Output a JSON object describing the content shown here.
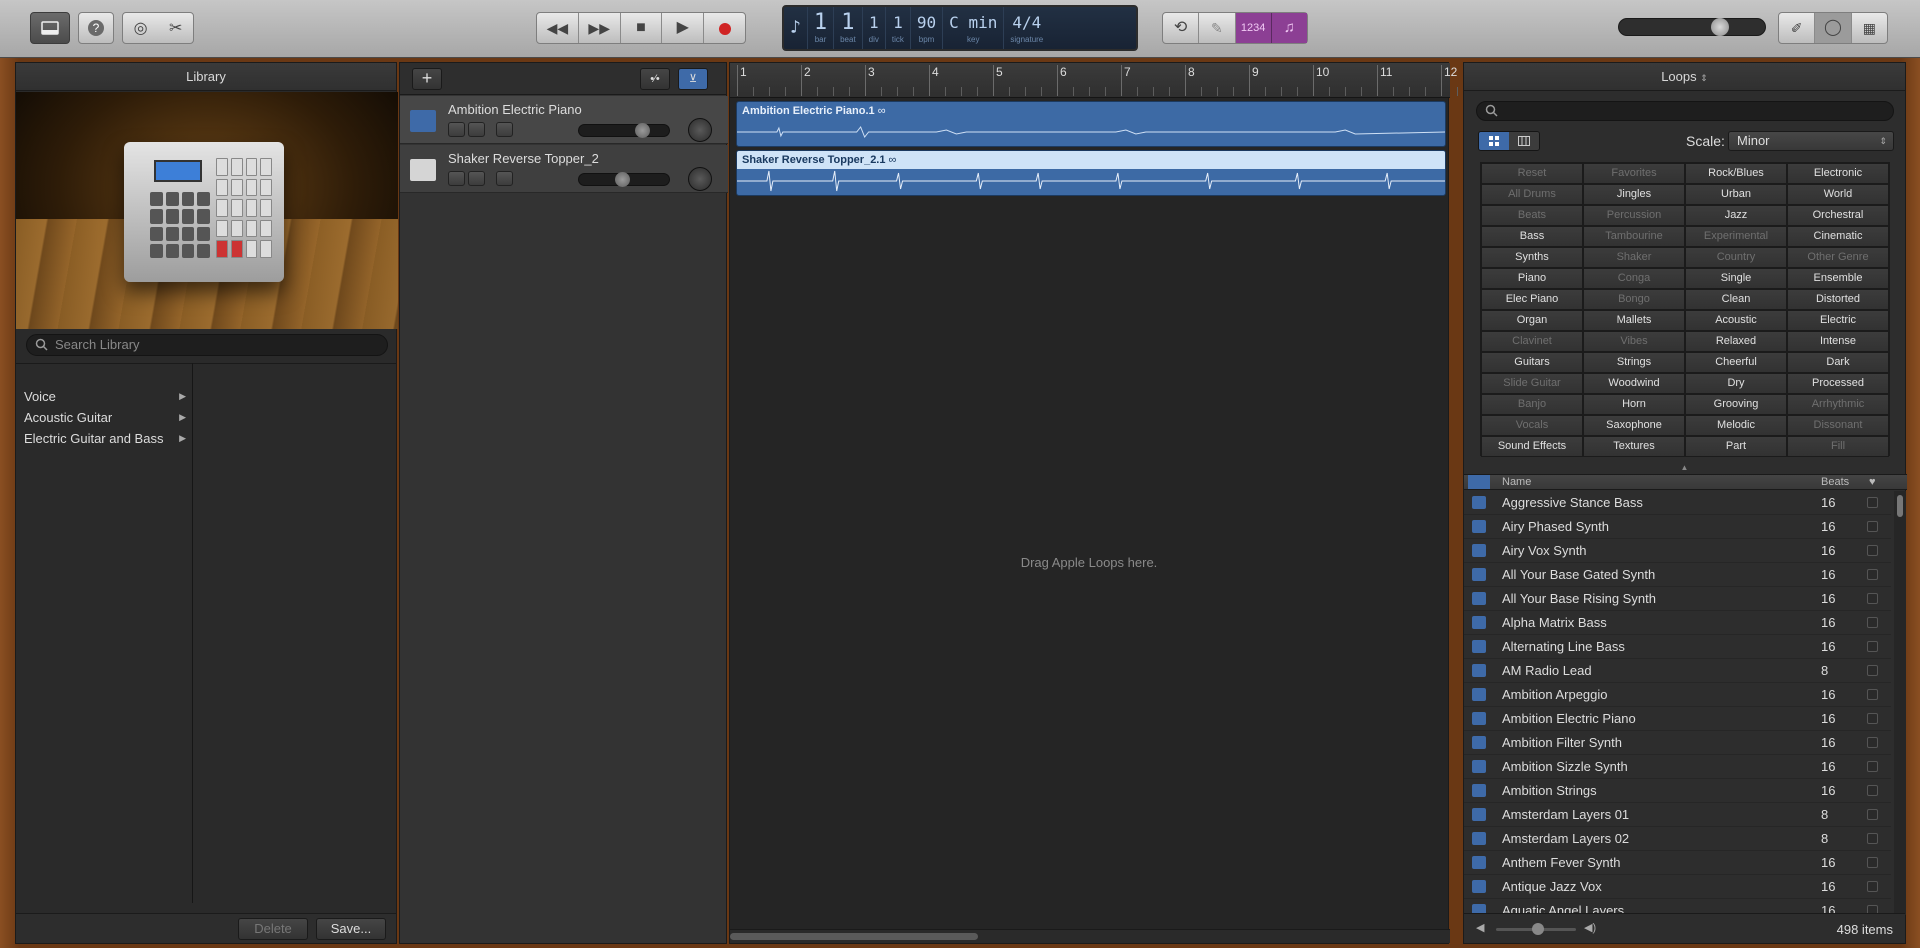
{
  "toolbar": {
    "lcd": {
      "bar": "1",
      "bar_label": "bar",
      "beat": "1",
      "beat_label": "beat",
      "div": "1",
      "div_label": "div",
      "tick": "1",
      "tick_label": "tick",
      "bpm": "90",
      "bpm_label": "bpm",
      "key": "C min",
      "key_label": "key",
      "signature": "4/4",
      "signature_label": "signature"
    },
    "count_in": "1234"
  },
  "library": {
    "title": "Library",
    "search_placeholder": "Search Library",
    "items": [
      {
        "label": "Voice"
      },
      {
        "label": "Acoustic Guitar"
      },
      {
        "label": "Electric Guitar and Bass"
      }
    ],
    "delete_label": "Delete",
    "save_label": "Save..."
  },
  "tracks": [
    {
      "name": "Ambition Electric Piano",
      "region": "Ambition Electric Piano.1"
    },
    {
      "name": "Shaker Reverse Topper_2",
      "region": "Shaker Reverse Topper_2.1"
    }
  ],
  "ruler": [
    "1",
    "2",
    "3",
    "4",
    "5",
    "6",
    "7",
    "8",
    "9",
    "10",
    "11",
    "12"
  ],
  "arrange": {
    "drag_hint": "Drag Apple Loops here."
  },
  "loops": {
    "title": "Loops",
    "scale_label": "Scale:",
    "scale_value": "Minor",
    "keywords": [
      {
        "label": "Reset",
        "dim": true
      },
      {
        "label": "Favorites",
        "dim": true
      },
      {
        "label": "Rock/Blues"
      },
      {
        "label": "Electronic"
      },
      {
        "label": "All Drums",
        "dim": true
      },
      {
        "label": "Jingles"
      },
      {
        "label": "Urban"
      },
      {
        "label": "World"
      },
      {
        "label": "Beats",
        "dim": true
      },
      {
        "label": "Percussion",
        "dim": true
      },
      {
        "label": "Jazz"
      },
      {
        "label": "Orchestral"
      },
      {
        "label": "Bass"
      },
      {
        "label": "Tambourine",
        "dim": true
      },
      {
        "label": "Experimental",
        "dim": true
      },
      {
        "label": "Cinematic"
      },
      {
        "label": "Synths"
      },
      {
        "label": "Shaker",
        "dim": true
      },
      {
        "label": "Country",
        "dim": true
      },
      {
        "label": "Other Genre",
        "dim": true
      },
      {
        "label": "Piano"
      },
      {
        "label": "Conga",
        "dim": true
      },
      {
        "label": "Single"
      },
      {
        "label": "Ensemble"
      },
      {
        "label": "Elec Piano"
      },
      {
        "label": "Bongo",
        "dim": true
      },
      {
        "label": "Clean"
      },
      {
        "label": "Distorted"
      },
      {
        "label": "Organ"
      },
      {
        "label": "Mallets"
      },
      {
        "label": "Acoustic"
      },
      {
        "label": "Electric"
      },
      {
        "label": "Clavinet",
        "dim": true
      },
      {
        "label": "Vibes",
        "dim": true
      },
      {
        "label": "Relaxed"
      },
      {
        "label": "Intense"
      },
      {
        "label": "Guitars"
      },
      {
        "label": "Strings"
      },
      {
        "label": "Cheerful"
      },
      {
        "label": "Dark"
      },
      {
        "label": "Slide Guitar",
        "dim": true
      },
      {
        "label": "Woodwind"
      },
      {
        "label": "Dry"
      },
      {
        "label": "Processed"
      },
      {
        "label": "Banjo",
        "dim": true
      },
      {
        "label": "Horn"
      },
      {
        "label": "Grooving"
      },
      {
        "label": "Arrhythmic",
        "dim": true
      },
      {
        "label": "Vocals",
        "dim": true
      },
      {
        "label": "Saxophone"
      },
      {
        "label": "Melodic"
      },
      {
        "label": "Dissonant",
        "dim": true
      },
      {
        "label": "Sound Effects"
      },
      {
        "label": "Textures"
      },
      {
        "label": "Part"
      },
      {
        "label": "Fill",
        "dim": true
      }
    ],
    "table": {
      "col_name": "Name",
      "col_beats": "Beats",
      "rows": [
        {
          "name": "Aggressive Stance Bass",
          "beats": "16"
        },
        {
          "name": "Airy Phased Synth",
          "beats": "16"
        },
        {
          "name": "Airy Vox Synth",
          "beats": "16"
        },
        {
          "name": "All Your Base Gated Synth",
          "beats": "16"
        },
        {
          "name": "All Your Base Rising Synth",
          "beats": "16"
        },
        {
          "name": "Alpha Matrix Bass",
          "beats": "16"
        },
        {
          "name": "Alternating Line Bass",
          "beats": "16"
        },
        {
          "name": "AM Radio Lead",
          "beats": "8"
        },
        {
          "name": "Ambition Arpeggio",
          "beats": "16"
        },
        {
          "name": "Ambition Electric Piano",
          "beats": "16"
        },
        {
          "name": "Ambition Filter Synth",
          "beats": "16"
        },
        {
          "name": "Ambition Sizzle Synth",
          "beats": "16"
        },
        {
          "name": "Ambition Strings",
          "beats": "16"
        },
        {
          "name": "Amsterdam Layers 01",
          "beats": "8"
        },
        {
          "name": "Amsterdam Layers 02",
          "beats": "8"
        },
        {
          "name": "Anthem Fever Synth",
          "beats": "16"
        },
        {
          "name": "Antique Jazz Vox",
          "beats": "16"
        },
        {
          "name": "Aquatic Angel Layers",
          "beats": "16"
        }
      ]
    },
    "items_count": "498 items"
  },
  "colors": {
    "region": "#3d6aa5",
    "region_selected_header": "#cfe3f7",
    "accent": "#3e6aa8"
  }
}
